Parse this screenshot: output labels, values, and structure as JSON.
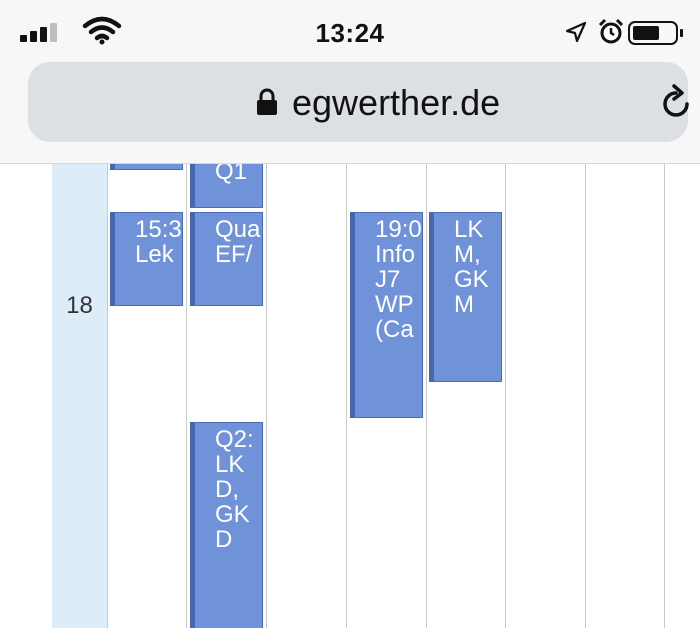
{
  "status_bar": {
    "time": "13:24",
    "icons": [
      "signal-icon",
      "wifi-icon",
      "location-arrow-icon",
      "alarm-icon",
      "battery-icon"
    ]
  },
  "browser": {
    "url": "egwerther.de",
    "icons": [
      "lock-icon",
      "reload-icon"
    ]
  },
  "calendar": {
    "hour_label": "18",
    "events": {
      "e1": "",
      "e2": "Q1",
      "e3": "15:3\nLek",
      "e4": "Qua\nEF/",
      "e5": "19:0\nInfo\nJ7\nWP\n(Ca",
      "e6": "LK\nM,\nGK\nM",
      "e7": "Q2:\nLK\nD,\nGK\nD"
    }
  },
  "colors": {
    "event_fill": "#7092d9",
    "event_border": "#4668b3",
    "hour_column": "#dcecf9"
  }
}
